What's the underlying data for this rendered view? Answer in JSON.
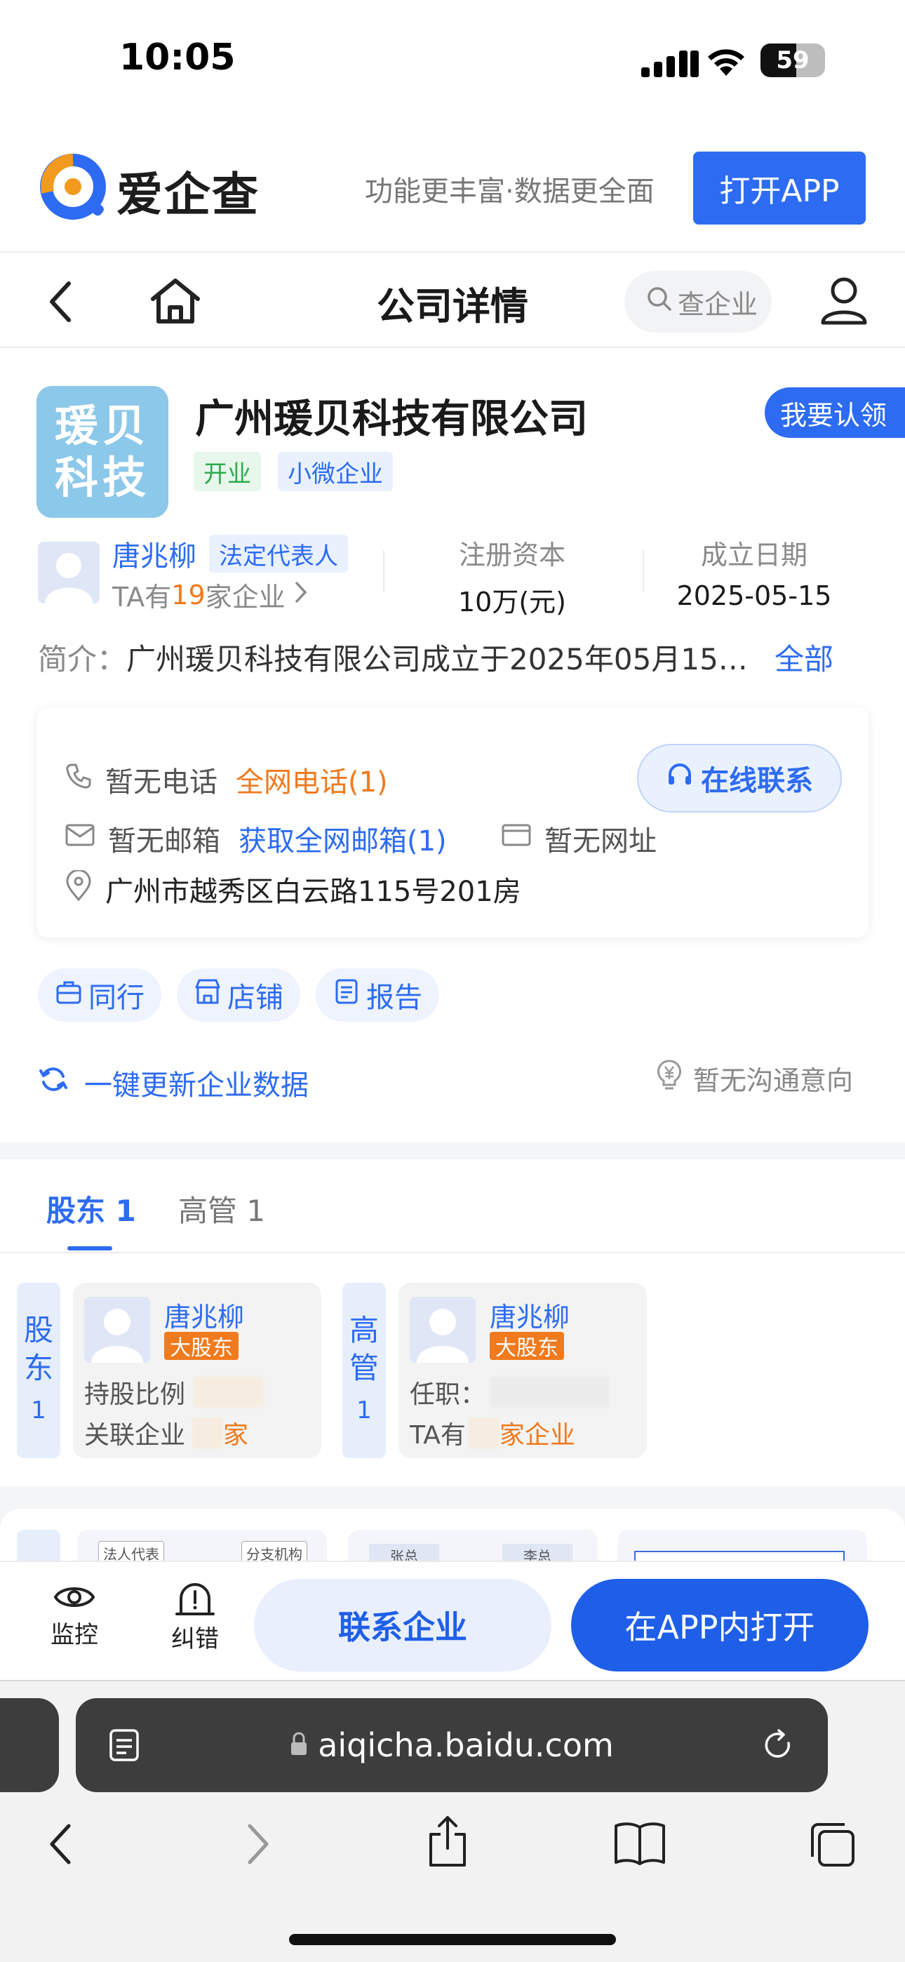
{
  "status_bar": {
    "time": "10:05",
    "battery": "59",
    "battery_level_percent": 59
  },
  "brand": {
    "name": "爱企查",
    "slogan": "功能更丰富·数据更全面",
    "open_app": "打开APP"
  },
  "nav": {
    "title": "公司详情",
    "search_placeholder": "查企业"
  },
  "company": {
    "logo_text": "瑗贝科技",
    "name": "广州瑗贝科技有限公司",
    "claim_button": "我要认领",
    "tags": [
      "开业",
      "小微企业"
    ],
    "legal_rep": {
      "name": "唐兆柳",
      "role_tag": "法定代表人",
      "companies_prefix": "TA有",
      "companies_count": "19",
      "companies_suffix": "家企业"
    },
    "registered_capital": {
      "label": "注册资本",
      "value": "10万(元)"
    },
    "established": {
      "label": "成立日期",
      "value": "2025-05-15"
    },
    "intro_label": "简介：",
    "intro_text": "广州瑗贝科技有限公司成立于2025年05月15…",
    "intro_more": "全部"
  },
  "contact": {
    "phone_status": "暂无电话",
    "phone_link": "全网电话(1)",
    "email_status": "暂无邮箱",
    "email_link": "获取全网邮箱(1)",
    "website_status": "暂无网址",
    "address": "广州市越秀区白云路115号201房",
    "online_button": "在线联系"
  },
  "quick_links": [
    "同行",
    "店铺",
    "报告"
  ],
  "update": {
    "label": "一键更新企业数据",
    "intent": "暂无沟通意向"
  },
  "people_tabs": [
    {
      "label": "股东 1"
    },
    {
      "label": "高管 1"
    }
  ],
  "shareholder_group": {
    "label_chars": "股东",
    "count": "1"
  },
  "executive_group": {
    "label_chars": "高管",
    "count": "1"
  },
  "shareholder": {
    "name": "唐兆柳",
    "badge": "大股东",
    "ratio_label": "持股比例",
    "related_label": "关联企业",
    "related_suffix": "家"
  },
  "executive": {
    "name": "唐兆柳",
    "badge": "大股东",
    "position_label": "任职：",
    "companies_prefix": "TA有",
    "companies_suffix": "家企业"
  },
  "preview_labels": [
    "法人代表",
    "分支机构",
    "张总",
    "李总"
  ],
  "action_bar": {
    "monitor": "监控",
    "correct": "纠错",
    "contact_company": "联系企业",
    "open_in_app": "在APP内打开"
  },
  "safari": {
    "url": "aiqicha.baidu.com"
  }
}
